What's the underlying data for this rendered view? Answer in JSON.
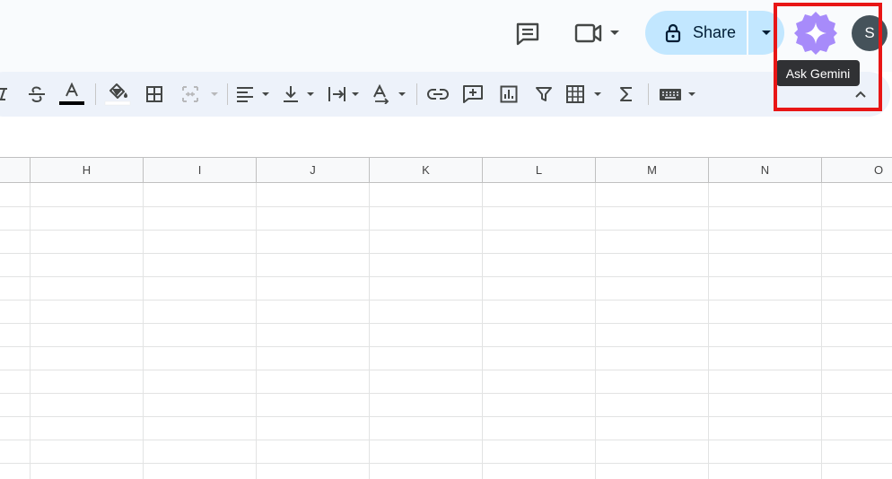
{
  "header": {
    "share_label": "Share",
    "avatar_initial": "S",
    "tooltip": "Ask Gemini"
  },
  "toolbar": {
    "items": [
      "strikethrough",
      "text-color",
      "fill-color",
      "borders",
      "merge-cells",
      "horizontal-align",
      "vertical-align",
      "text-wrapping",
      "text-rotation",
      "insert-link",
      "insert-comment",
      "insert-chart",
      "create-filter",
      "filter-views",
      "functions",
      "input-tools",
      "hide-menus"
    ]
  },
  "grid": {
    "columns": [
      "H",
      "I",
      "J",
      "K",
      "L",
      "M",
      "N",
      "O"
    ]
  },
  "colors": {
    "share_bg": "#c2e7ff",
    "gemini_accent": "#a78bfa",
    "highlight": "#e81616",
    "toolbar_bg": "#edf2fa"
  }
}
